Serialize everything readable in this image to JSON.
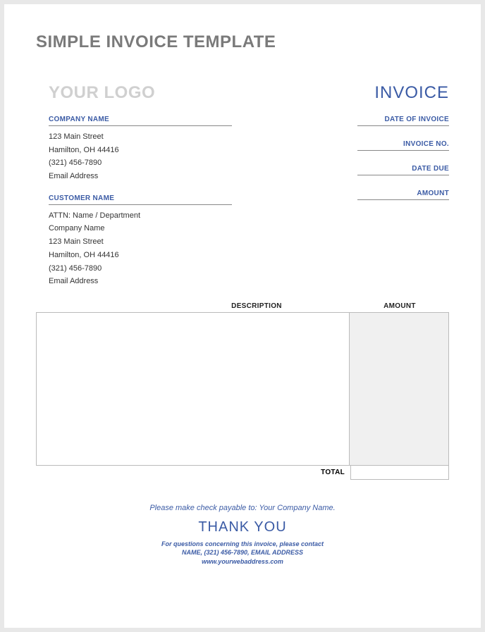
{
  "title": "SIMPLE INVOICE TEMPLATE",
  "logo": "YOUR LOGO",
  "invoiceWord": "INVOICE",
  "company": {
    "heading": "COMPANY NAME",
    "lines": [
      "123 Main Street",
      "Hamilton, OH  44416",
      "(321) 456-7890",
      "Email Address"
    ]
  },
  "customer": {
    "heading": "CUSTOMER NAME",
    "lines": [
      "ATTN: Name / Department",
      "Company Name",
      "123 Main Street",
      "Hamilton, OH  44416",
      "(321) 456-7890",
      "Email Address"
    ]
  },
  "rightFields": [
    "DATE OF INVOICE",
    "INVOICE NO.",
    "DATE DUE",
    "AMOUNT"
  ],
  "table": {
    "descHeader": "DESCRIPTION",
    "amtHeader": "AMOUNT",
    "totalLabel": "TOTAL"
  },
  "footer": {
    "payable": "Please make check payable to: Your Company Name.",
    "thankyou": "THANK YOU",
    "contact1": "For questions concerning this invoice, please contact",
    "contact2": "NAME, (321) 456-7890, EMAIL ADDRESS",
    "contact3": "www.yourwebaddress.com"
  }
}
